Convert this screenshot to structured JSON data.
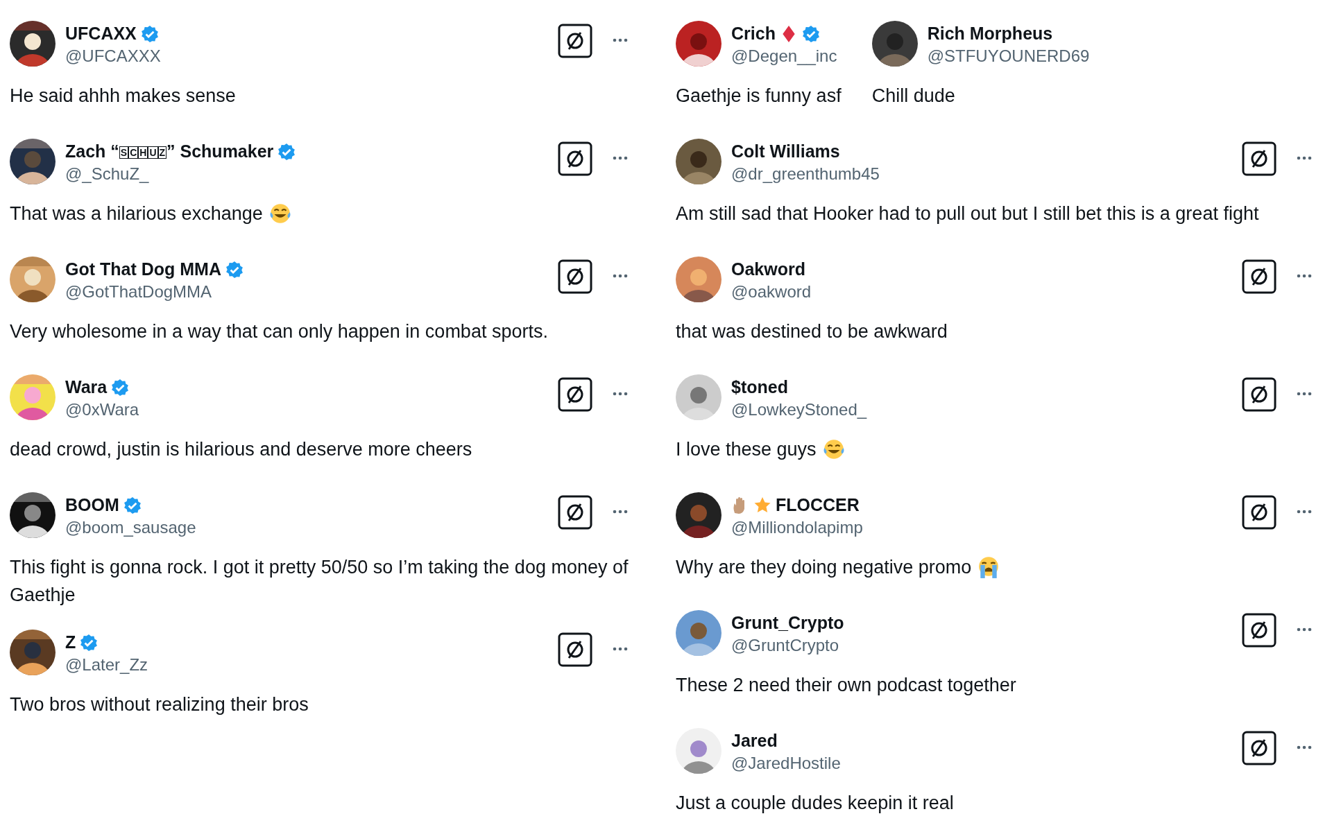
{
  "left": [
    {
      "name": "UFCAXX",
      "handle": "@UFCAXXX",
      "text": "He said ahhh makes sense",
      "verified": true,
      "actions": true
    },
    {
      "name": "Zach “",
      "boxed": "SCHUZ",
      "name_end": "” Schumaker",
      "handle": "@_SchuZ_",
      "text": "That was a hilarious exchange",
      "emoji": {
        "kind": "laughing"
      },
      "verified": true,
      "actions": true
    },
    {
      "name": "Got That Dog MMA",
      "handle": "@GotThatDogMMA",
      "text": "Very wholesome in a way that can only happen in combat sports.",
      "verified": true,
      "actions": true
    },
    {
      "name": "Wara",
      "handle": "@0xWara",
      "text": "dead crowd, justin is hilarious and deserve more cheers",
      "verified": true,
      "actions": true
    },
    {
      "name": "BOOM",
      "handle": "@boom_sausage",
      "text": "This fight is gonna rock. I got it pretty 50/50 so I’m taking the dog money of Gaethje",
      "verified": true,
      "actions": true
    },
    {
      "name": "Z",
      "handle": "@Later_Zz",
      "text": "Two bros without realizing their bros",
      "verified": true,
      "actions": true
    }
  ],
  "right_top": [
    {
      "name": "Crich",
      "handle": "@Degen__inc",
      "text": "Gaethje is funny asf",
      "badge": {
        "kind": "diamond"
      },
      "verified": true,
      "actions": false
    },
    {
      "name": "Rich Morpheus",
      "handle": "@STFUYOUNERD69",
      "text": "Chill dude",
      "verified": false,
      "actions": false
    }
  ],
  "right": [
    {
      "name": "Colt Williams",
      "handle": "@dr_greenthumb45",
      "text": "Am still sad that Hooker had to pull out but I still bet this is a great fight",
      "verified": false,
      "actions": true
    },
    {
      "name": "Oakword",
      "handle": "@oakword",
      "text": "that was destined to be awkward",
      "verified": false,
      "actions": true
    },
    {
      "name": "$toned",
      "handle": "@LowkeyStoned_",
      "text": "I love these guys",
      "emoji": {
        "kind": "laughing"
      },
      "verified": false,
      "actions": true
    },
    {
      "name": "FLOCCER",
      "lead": [
        {
          "kind": "hand"
        },
        {
          "kind": "star"
        }
      ],
      "handle": "@Milliondolapimp",
      "text": "Why are they doing negative promo",
      "emoji": {
        "kind": "crying"
      },
      "verified": false,
      "actions": true
    },
    {
      "name": "Grunt_Crypto",
      "handle": "@GruntCrypto",
      "text": "These 2 need their own podcast together",
      "verified": false,
      "actions": true
    },
    {
      "name": "Jared",
      "handle": "@JaredHostile",
      "text": "Just a couple dudes keepin it real",
      "verified": false,
      "actions": true
    }
  ]
}
